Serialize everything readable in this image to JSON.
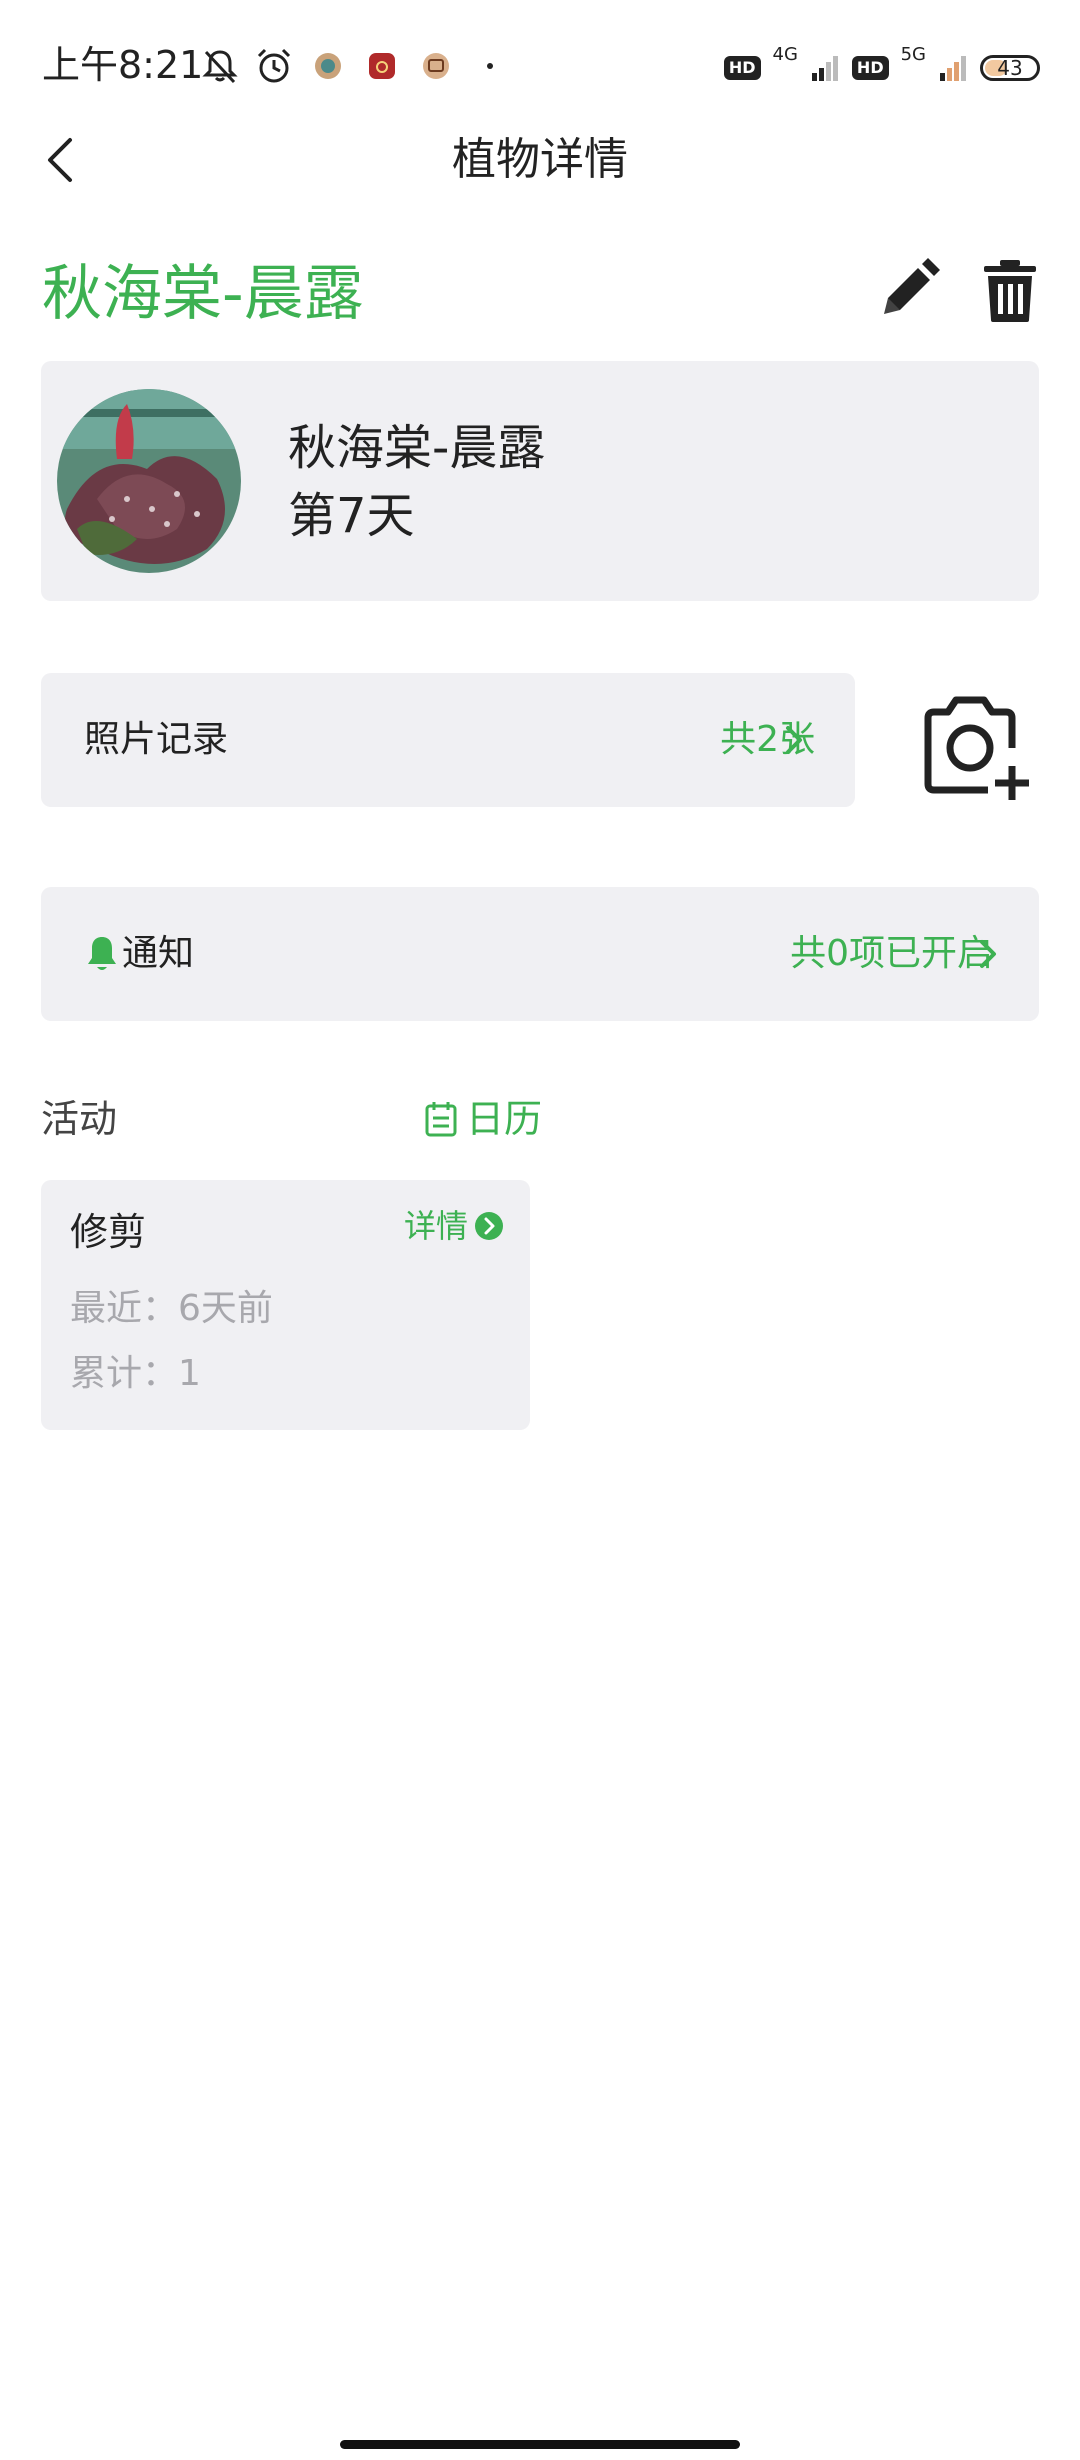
{
  "status_bar": {
    "time": "上午8:21",
    "net1": "4G",
    "net2": "5G",
    "hd1": "HD",
    "hd2": "HD",
    "battery": "43",
    "battery_level": 0.43
  },
  "nav": {
    "title": "植物详情"
  },
  "plant": {
    "title": "秋海棠-晨露",
    "card_name": "秋海棠-晨露",
    "card_days": "第7天"
  },
  "photo_record": {
    "label": "照片记录",
    "count": "共2张"
  },
  "notify": {
    "label": "通知",
    "status": "共0项已开启"
  },
  "activity": {
    "heading": "活动",
    "calendar": "日历",
    "cards": [
      {
        "title": "修剪",
        "detail": "详情",
        "recent": "最近：6天前",
        "total": "累计：1"
      }
    ]
  },
  "colors": {
    "accent": "#3db152",
    "card_bg": "#f0f0f3",
    "muted_text": "#a8a8ad"
  }
}
